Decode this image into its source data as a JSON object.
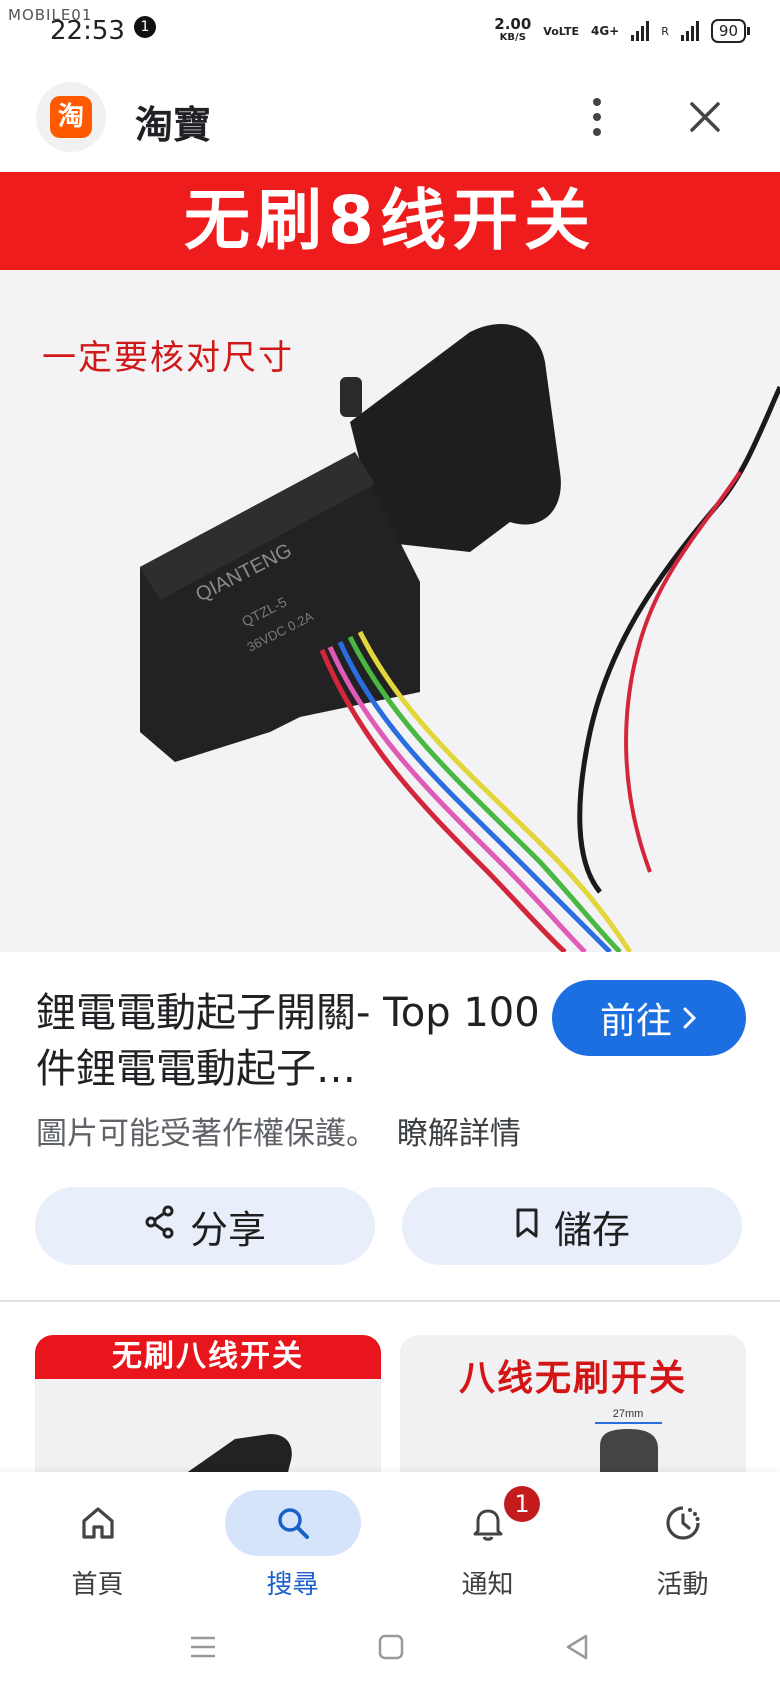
{
  "status_bar": {
    "watermark": "MOBILE01",
    "time": "22:53",
    "notification_count": "1",
    "net_speed_value": "2.00",
    "net_speed_unit": "KB/S",
    "volte": "VoLTE",
    "network": "4G+",
    "roaming": "R",
    "battery": "90"
  },
  "app_bar": {
    "logo_char": "淘",
    "title": "淘寶",
    "menu_icon": "more-vert-icon",
    "close_icon": "close-icon"
  },
  "hero_image": {
    "banner_text": "无刷8线开关",
    "caption": "一定要核对尺寸",
    "brand_mark": "QIANTENG",
    "model_text": "QTZL-5",
    "rating_text": "36VDC 0.2A",
    "banner_color": "#ee1c1c"
  },
  "result": {
    "title": "鋰電電動起子開關- Top 100件鋰電電動起子…",
    "goto_label": "前往",
    "copyright_text": "圖片可能受著作權保護。",
    "learn_more": "瞭解詳情"
  },
  "actions": {
    "share_label": "分享",
    "save_label": "儲存"
  },
  "related": [
    {
      "banner": "无刷八线开关"
    },
    {
      "banner": "八线无刷开关",
      "dimension_label": "27mm"
    }
  ],
  "bottom_nav": {
    "items": [
      {
        "label": "首頁",
        "icon": "home-icon"
      },
      {
        "label": "搜尋",
        "icon": "search-icon"
      },
      {
        "label": "通知",
        "icon": "bell-icon",
        "badge": "1"
      },
      {
        "label": "活動",
        "icon": "activity-icon"
      }
    ],
    "active_index": 1
  },
  "colors": {
    "accent_blue": "#1b6fe0",
    "pill_bg": "#e8effa",
    "badge_red": "#c41c1c"
  }
}
